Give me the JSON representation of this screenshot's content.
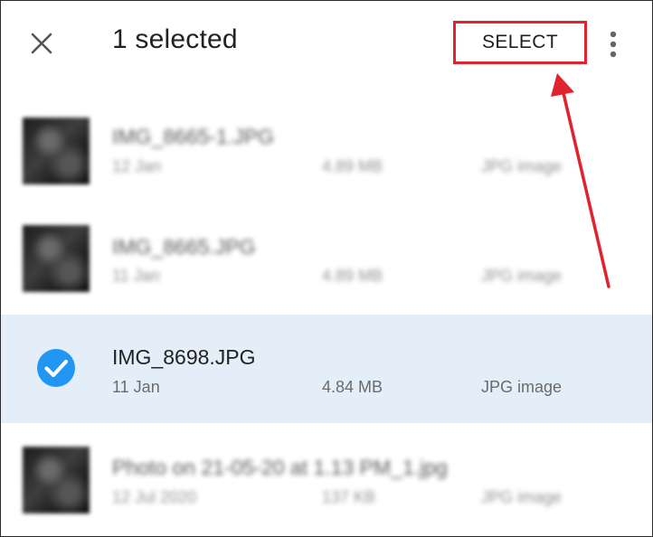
{
  "header": {
    "title": "1 selected",
    "select_label": "SELECT",
    "close_icon": "close-icon",
    "more_icon": "more-vert-icon"
  },
  "colors": {
    "highlight_border": "#e0232e",
    "selected_row_bg": "#e3eef9",
    "check_blue": "#2196f3"
  },
  "files": [
    {
      "name": "IMG_8665-1.JPG",
      "date": "12 Jan",
      "size": "4.89 MB",
      "type": "JPG image",
      "selected": false
    },
    {
      "name": "IMG_8665.JPG",
      "date": "11 Jan",
      "size": "4.89 MB",
      "type": "JPG image",
      "selected": false
    },
    {
      "name": "IMG_8698.JPG",
      "date": "11 Jan",
      "size": "4.84 MB",
      "type": "JPG image",
      "selected": true
    },
    {
      "name": "Photo on 21-05-20 at 1.13 PM_1.jpg",
      "date": "12 Jul 2020",
      "size": "137 KB",
      "type": "JPG image",
      "selected": false
    }
  ]
}
